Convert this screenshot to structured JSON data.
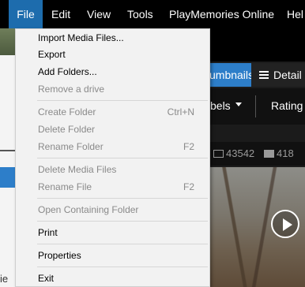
{
  "menubar": {
    "items": [
      "File",
      "Edit",
      "View",
      "Tools",
      "PlayMemories Online",
      "Hel"
    ]
  },
  "background": {
    "thumbnails_label": "umbnails",
    "details_label": "Detail",
    "labels_label": "bels",
    "rating_label": "Rating",
    "photo_count": "43542",
    "video_count": "418",
    "left_partial_text": "ie"
  },
  "file_menu": {
    "import": "Import Media Files...",
    "export": "Export",
    "add_folders": "Add Folders...",
    "remove_drive": "Remove a drive",
    "create_folder": "Create Folder",
    "create_folder_shortcut": "Ctrl+N",
    "delete_folder": "Delete Folder",
    "rename_folder": "Rename Folder",
    "rename_folder_shortcut": "F2",
    "delete_media": "Delete Media Files",
    "rename_file": "Rename File",
    "rename_file_shortcut": "F2",
    "open_containing": "Open Containing Folder",
    "print": "Print",
    "properties": "Properties",
    "exit": "Exit"
  },
  "colors": {
    "accent": "#1d6cad",
    "menu_bg": "#f2f2f2",
    "disabled_text": "#8a8a8a"
  }
}
